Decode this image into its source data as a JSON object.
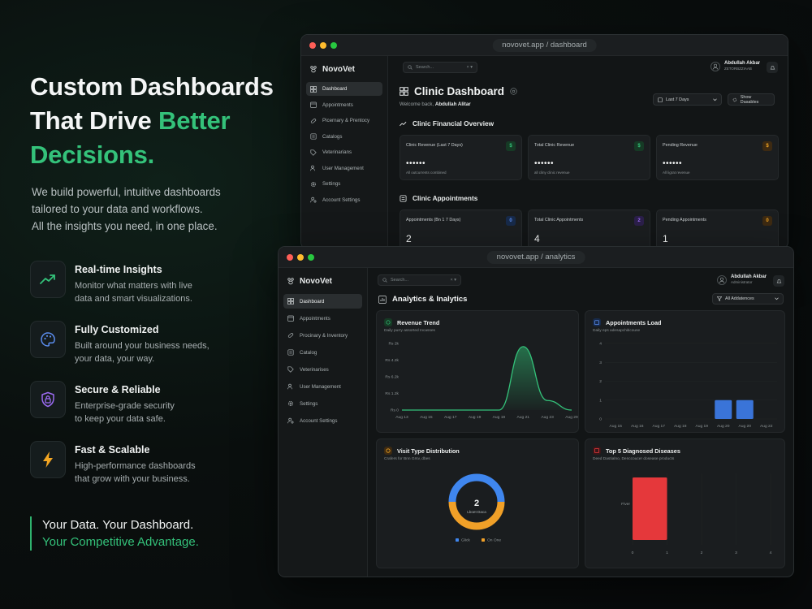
{
  "hero": {
    "title_l1": "Custom Dashboards",
    "title_l2a": "That Drive ",
    "title_l2b": "Better",
    "title_l3": "Decisions.",
    "sub_l1": "We build powerful, intuitive dashboards",
    "sub_l2": "tailored to your data and workflows.",
    "sub_l3": "All the insights you need, in one place."
  },
  "features": [
    {
      "title": "Real-time Insights",
      "desc_l1": "Monitor what matters with live",
      "desc_l2": "data and smart visualizations.",
      "icon": "trend-up-icon",
      "color": "#34c27a"
    },
    {
      "title": "Fully Customized",
      "desc_l1": "Built around your business needs,",
      "desc_l2": "your data, your way.",
      "icon": "palette-icon",
      "color": "#5b8def"
    },
    {
      "title": "Secure & Reliable",
      "desc_l1": "Enterprise-grade security",
      "desc_l2": "to keep your data safe.",
      "icon": "shield-lock-icon",
      "color": "#9b6bf2"
    },
    {
      "title": "Fast & Scalable",
      "desc_l1": "High-performance dashboards",
      "desc_l2": "that grow with your business.",
      "icon": "lightning-icon",
      "color": "#f3a623"
    }
  ],
  "tagline": {
    "l1": "Your Data. Your Dashboard.",
    "l2": "Your Competitive Advantage."
  },
  "back_window": {
    "url": "novovet.app / dashboard",
    "brand": "NovoVet",
    "nav": [
      "Dashboard",
      "Appointments",
      "Picernary & Prentocy",
      "Catalogs",
      "Veterinarians",
      "User Management",
      "Settings",
      "Account Settings"
    ],
    "search_placeholder": "Search...",
    "search_shortcut": "× ▾",
    "user_name": "Abdullah Akbar",
    "user_role": "ZETORBZZIAAB",
    "page_title": "Clinic Dashboard",
    "welcome_prefix": "Welcome back, ",
    "welcome_name": "Abdullah Alitar",
    "date_filter": "Last 7 Days",
    "show_btn": "Show Dasables",
    "financial_title": "Clinic Financial Overview",
    "financial_cards": [
      {
        "label": "Clinic Revenue (Last 7 Days)",
        "value": "••••••",
        "sub": "All outcurrents combined",
        "badge": "$"
      },
      {
        "label": "Total Clinic Revenue",
        "value": "••••••",
        "sub": "all cliny clinic revenue",
        "badge": "$"
      },
      {
        "label": "Pending Revenue",
        "value": "••••••",
        "sub": "All ligrat revenue",
        "badge": "$"
      }
    ],
    "appointments_title": "Clinic Appointments",
    "appointment_cards": [
      {
        "label": "Appointments (Bn 1 7 Days)",
        "value": "2",
        "badge": "0"
      },
      {
        "label": "Total Clinic Appointments",
        "value": "4",
        "badge": "2"
      },
      {
        "label": "Pending Appointments",
        "value": "1",
        "badge": "0"
      }
    ]
  },
  "front_window": {
    "url": "novovet.app / analytics",
    "brand": "NovoVet",
    "nav": [
      "Dashboard",
      "Appointments",
      "Procinary & Inventory",
      "Catalog",
      "Veterinarises",
      "User Management",
      "Settings",
      "Account Settings"
    ],
    "search_placeholder": "Search...",
    "search_shortcut": "× ▾",
    "user_name": "Abdullah Akbar",
    "user_role": "Administrator",
    "page_title": "Analytics & Inalytics",
    "filter": "All Addatences",
    "revenue": {
      "title": "Revenue Trend",
      "sub": "Daily purry assorted Incasses"
    },
    "appointments": {
      "title": "Appointments Load",
      "sub": "Daily eps adesapchiticouse"
    },
    "visit": {
      "title": "Visit Type Distribution",
      "sub": "Crafers for Bnn Grsv, dbes",
      "center_value": "2",
      "center_label": "Lboet Daca"
    },
    "diseases": {
      "title": "Top 5 Diagnosed Diseases",
      "sub": "Deed Dastialno, Denccoucer dosease products"
    }
  },
  "chart_data": [
    {
      "type": "line",
      "title": "Revenue Trend",
      "x": [
        "Aug 13",
        "Aug 15",
        "Aug 17",
        "Aug 19",
        "Aug 19",
        "Aug 21",
        "Aug 23",
        "Aug 29"
      ],
      "y_ticks": [
        "Rs 2k",
        "Rs 4.2k",
        "Rs 6.2k",
        "Rs 1.2k",
        "Rs 0"
      ],
      "series": [
        {
          "values": [
            0,
            0,
            0,
            0,
            0,
            4.0,
            0.6,
            0
          ]
        }
      ],
      "ylim": [
        0,
        4.2
      ]
    },
    {
      "type": "bar",
      "title": "Appointments Load",
      "categories": [
        "Aug 15",
        "Aug 16",
        "Aug 17",
        "Aug 18",
        "Aug 19",
        "Aug 20",
        "Aug 20",
        "Aug 22"
      ],
      "values": [
        0,
        0,
        0,
        0,
        0,
        1,
        1,
        0
      ],
      "y_ticks": [
        "4",
        "3",
        "2",
        "1",
        "0"
      ],
      "ylim": [
        0,
        4
      ],
      "color": "#3a74d8"
    },
    {
      "type": "pie",
      "title": "Visit Type Distribution",
      "categories": [
        "Glick",
        "On One"
      ],
      "values": [
        1,
        1
      ],
      "colors": [
        "#3f86ee",
        "#f0a028"
      ]
    },
    {
      "type": "bar",
      "title": "Top 5 Diagnosed Diseases",
      "orientation": "horizontal",
      "categories": [
        "Fiver"
      ],
      "values": [
        1
      ],
      "x_ticks": [
        "0",
        "1",
        "2",
        "3",
        "4"
      ],
      "xlim": [
        0,
        4
      ],
      "color": "#e5383b"
    }
  ]
}
